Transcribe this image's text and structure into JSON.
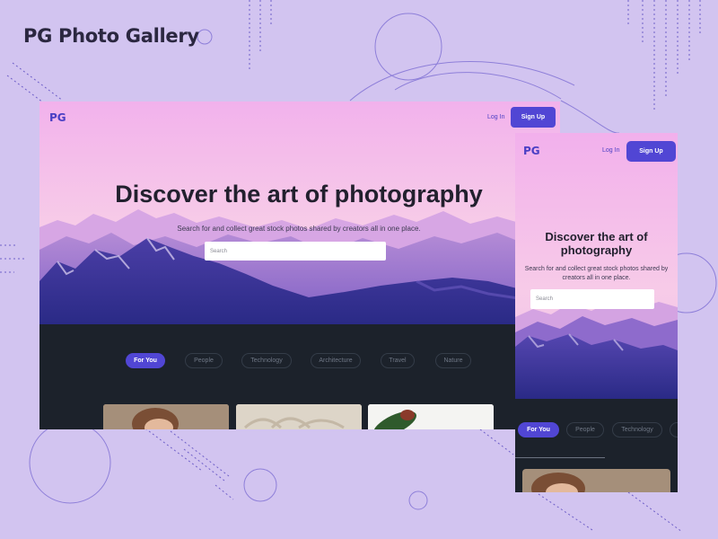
{
  "brand": {
    "title": "PG Photo Gallery"
  },
  "site": {
    "logo": "PG",
    "login_label": "Log In",
    "signup_label": "Sign Up",
    "hero_title": "Discover the art of photography",
    "hero_subtitle": "Search for and collect great stock photos shared by creators all in one place.",
    "search_placeholder": "Search",
    "categories": [
      "For You",
      "People",
      "Technology",
      "Architecture",
      "Travel",
      "Nature"
    ],
    "active_category": "For You"
  },
  "colors": {
    "background": "#d2c4f0",
    "accent": "#5146d4",
    "dark_panel": "#1c222b",
    "text_dark": "#22202e"
  }
}
